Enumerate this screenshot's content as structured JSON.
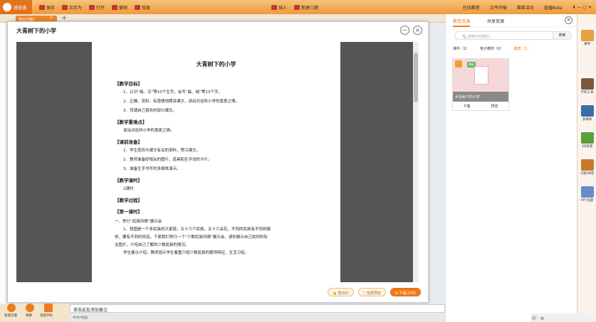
{
  "app": {
    "logo": "班班通",
    "toolbar": [
      "保存",
      "另存为",
      "打开",
      "撤销",
      "恢复"
    ],
    "insert": "插入",
    "new_exercise": "新建习题",
    "right_links": [
      "在线教程",
      "文件传输",
      "赛事活动",
      "直播Beta"
    ]
  },
  "tab": {
    "label": "演示文稿1"
  },
  "preview": {
    "title": "大青树下的小学"
  },
  "doc": {
    "title": "大青树下的小学",
    "sections": [
      {
        "h": "【教学目标】",
        "lines": [
          "1．认识“绒、汉”等10个生字，会写“晨、绒”等13个字。",
          "2．正确、流利、有感情地朗读课文，读出对这所小学的喜爱之情。",
          "3．背诵自己喜欢的部分课文。"
        ]
      },
      {
        "h": "【教学重难点】",
        "lines": [
          "读出对这所小学的喜爱之情。"
        ]
      },
      {
        "h": "【课前准备】",
        "lines": [
          "1．学生查找与课文有关的资料，预习课文。",
          "2．教师准备好相关的图片、道具和生字词的卡片。",
          "3．准备生字书写的多媒体演示。"
        ]
      },
      {
        "h": "【教学课时】",
        "lines": [
          "2课时"
        ]
      },
      {
        "h": "【教学过程】",
        "lines": []
      },
      {
        "h": "【第一课时】",
        "lines": []
      }
    ],
    "para_head": "一、举行“民族风情”展示会",
    "paras": [
      "1．我国是一个多民族的大家庭，五十六个民族，五十六朵花，不同的民族有不同的服",
      "饰，要有不同的风俗。下面我们举行一个“少数民族风情”展示会，请你展示自己找到的有",
      "关图片，介绍自己了解的少数民族的情况。",
      "学生展示介绍，教师提示学生着重介绍少数民族的服饰特征、生活习俗。"
    ]
  },
  "footer": {
    "like": "赞(60)",
    "fullscreen": "全屏预览",
    "download": "下载(278)"
  },
  "notes": "单击此处添加备注",
  "status": "中文(中国)",
  "bottom_left": [
    "新建页面",
    "转换",
    "连接手机"
  ],
  "panel": {
    "tabs": [
      "教育资源",
      "共享资源"
    ],
    "search_placeholder": "搜索你想要的...",
    "search_btn": "搜索",
    "subtabs": [
      "课件（1）",
      "电子教材（0）",
      "教案（1）"
    ],
    "card": {
      "badge": "最新",
      "name": "大青树下的小学",
      "actions": [
        "下载",
        "预览"
      ]
    }
  },
  "tools": [
    "课件",
    "学科工具",
    "多媒体",
    "3D资源",
    "习题/试卷",
    "PPT主题"
  ],
  "tray": "中 · ⚙"
}
